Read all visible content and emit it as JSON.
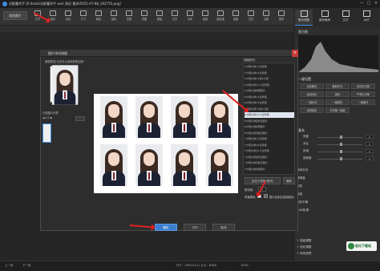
{
  "window": {
    "app_name": "光影魔术手",
    "title": "光影魔术手 [E:\\tools\\光影魔术手 xxx\\ 测试 素材\\5051-07-88_162755.png]",
    "controls": [
      "—",
      "□",
      "×"
    ]
  },
  "toolbar": {
    "open_label": "浏览图片",
    "tools": [
      "打开",
      "保存",
      "另存",
      "尺寸",
      "裁剪",
      "旋转",
      "边框",
      "拼图",
      "模板",
      "文字",
      "水印",
      "画笔",
      "批处理",
      "抠图",
      "日历",
      "证照",
      "更多"
    ]
  },
  "right_tabs": [
    "基本调整",
    "数码暗房",
    "文字",
    "水印"
  ],
  "right_panel": {
    "histogram_title": "直方图",
    "auto_label": "一键设置",
    "quick_buttons": [
      "自动曝光",
      "数码补光",
      "自动白平衡",
      "自动对比",
      "锐化",
      "严重白平衡",
      "一键补光",
      "一键锐化",
      "一键美白",
      "自然锐化",
      "白平衡一指键"
    ],
    "basic_title": "基本",
    "sliders": [
      {
        "label": "亮度",
        "value": "0",
        "fraction": 0.5
      },
      {
        "label": "对比",
        "value": "0",
        "fraction": 0.5
      },
      {
        "label": "色相",
        "value": "0",
        "fraction": 0.5
      },
      {
        "label": "饱和度",
        "value": "0",
        "fraction": 0.5
      }
    ],
    "list": [
      "数码补光",
      "清晰度",
      "色阶",
      "曲线",
      "色彩平衡",
      "RGB色调"
    ],
    "collapsed": [
      "+ 高级调整",
      "+ 色彩调整",
      "+ 特效滤镜"
    ]
  },
  "dialog": {
    "title": "图片冲印排版",
    "preview_label": "原图预览(点击可以选择其他位置)",
    "thumbs_label": "已选图片列表",
    "nav_label": "◀ 1/1 ▶",
    "layout_title": "排版样式：",
    "layouts": [
      "5寸照片排1寸证件照",
      "5寸照片排2寸证件照",
      "5寸照片排1寸和2寸照",
      "5寸照片排小1寸证件照",
      "5寸照片排护照照片",
      "6寸照片排1寸证件照",
      "6寸照片排2寸证件照",
      "6寸照片排1寸和2寸照",
      "6寸照片排小1寸证件照",
      "6寸照片排身份证照片",
      "6寸照片排护照照片",
      "6寸照片排驾驶证照片",
      "7寸照片排1寸证件照",
      "7寸照片排2寸证件照",
      "7寸照片排小1寸证件照",
      "7寸照片排身份证照片",
      "7寸照片排驾驶证照片",
      "7寸照片排护照照片"
    ],
    "selected_layout": 8,
    "edit_btn": "自定义排版(修改)",
    "delete_btn": "删除",
    "cut_line_label": "剪切线：",
    "cut_line_value": "0",
    "bg_label": "背景颜色：",
    "auto_fit_label": "照片自适应(智能裁剪)",
    "buttons": {
      "ok": "确定",
      "print": "打印",
      "cancel": "取消"
    }
  },
  "status": {
    "prev": "上一张",
    "next": "下一张",
    "info": "尺寸：295×413 | 大小：62KB",
    "zoom": "100%"
  },
  "watermark": {
    "text": "极光下载站"
  },
  "colors": {
    "accent": "#3c8ee6",
    "annotation_arrow": "#e02020",
    "ok_button": "#3c7fcf"
  }
}
